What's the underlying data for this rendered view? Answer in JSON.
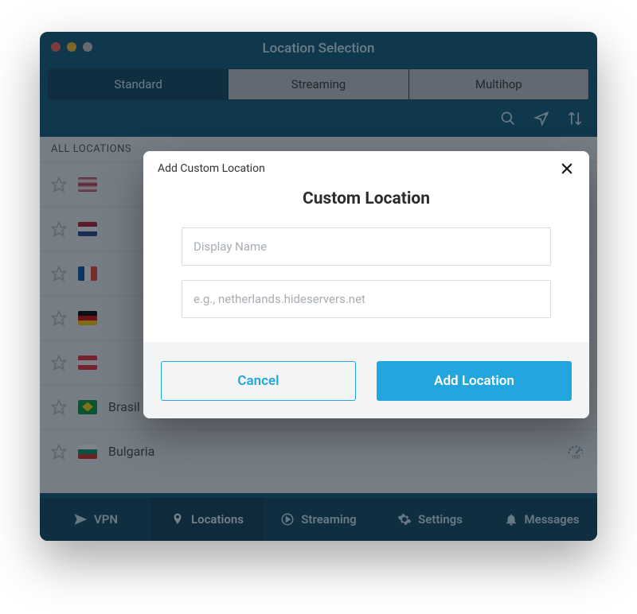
{
  "window": {
    "title": "Location Selection"
  },
  "segmented": {
    "items": [
      "Standard",
      "Streaming",
      "Multihop"
    ],
    "activeIndex": 0
  },
  "toolbar": {
    "icons": [
      "search-icon",
      "add-location-icon",
      "sort-icon"
    ]
  },
  "list": {
    "header": "ALL LOCATIONS",
    "rows": [
      {
        "name": "",
        "flag": "fl-us",
        "pinned": true
      },
      {
        "name": "",
        "flag": "fl-nl"
      },
      {
        "name": "",
        "flag": "fl-fr"
      },
      {
        "name": "",
        "flag": "fl-de",
        "speed": true
      },
      {
        "name": "",
        "flag": "fl-at",
        "speed": true
      },
      {
        "name": "Brasil",
        "flag": "fl-br",
        "speed": true
      },
      {
        "name": "Bulgaria",
        "flag": "fl-bg",
        "speed": true
      }
    ]
  },
  "bottomNav": {
    "items": [
      {
        "label": "VPN",
        "icon": "send-icon"
      },
      {
        "label": "Locations",
        "icon": "location-icon"
      },
      {
        "label": "Streaming",
        "icon": "play-icon"
      },
      {
        "label": "Settings",
        "icon": "gear-icon"
      },
      {
        "label": "Messages",
        "icon": "bell-icon"
      }
    ],
    "activeIndex": 1
  },
  "modal": {
    "smallTitle": "Add Custom Location",
    "title": "Custom Location",
    "displayName": {
      "value": "",
      "placeholder": "Display Name"
    },
    "server": {
      "value": "",
      "placeholder": "e.g., netherlands.hideservers.net"
    },
    "cancel": "Cancel",
    "add": "Add Location"
  }
}
